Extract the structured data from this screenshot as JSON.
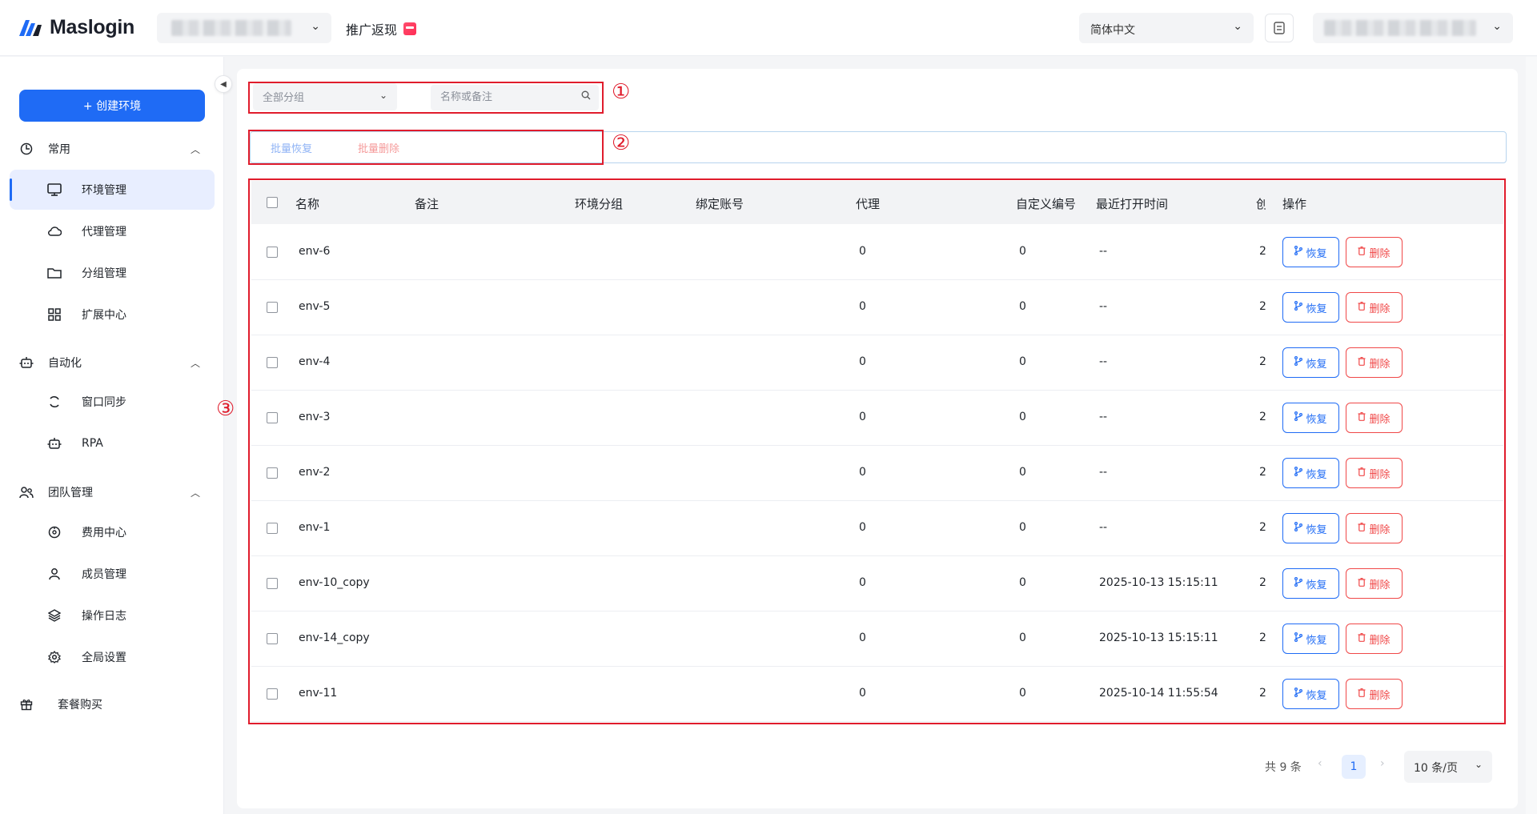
{
  "header": {
    "logo_text": "Maslogin",
    "promo_label": "推广返现",
    "language": "简体中文"
  },
  "sidebar": {
    "create_label": "+ 创建环境",
    "groups": [
      {
        "label": "常用",
        "icon": "dashboard-icon"
      },
      {
        "label": "自动化",
        "icon": "robot-icon"
      },
      {
        "label": "团队管理",
        "icon": "team-icon"
      }
    ],
    "items": [
      {
        "label": "环境管理",
        "icon": "monitor-icon",
        "active": true
      },
      {
        "label": "代理管理",
        "icon": "cloud-icon"
      },
      {
        "label": "分组管理",
        "icon": "folder-icon"
      },
      {
        "label": "扩展中心",
        "icon": "grid-icon"
      },
      {
        "label": "窗口同步",
        "icon": "sync-icon"
      },
      {
        "label": "RPA",
        "icon": "robot-icon"
      },
      {
        "label": "费用中心",
        "icon": "billing-icon"
      },
      {
        "label": "成员管理",
        "icon": "user-icon"
      },
      {
        "label": "操作日志",
        "icon": "layers-icon"
      },
      {
        "label": "全局设置",
        "icon": "gear-icon"
      }
    ],
    "package_label": "套餐购买"
  },
  "filters": {
    "group_select": "全部分组",
    "search_placeholder": "名称或备注"
  },
  "batch": {
    "restore_label": "批量恢复",
    "delete_label": "批量删除"
  },
  "annotations": [
    "①",
    "②",
    "③"
  ],
  "table": {
    "columns": [
      "名称",
      "备注",
      "环境分组",
      "绑定账号",
      "代理",
      "自定义编号",
      "最近打开时间",
      "创",
      "操作"
    ],
    "restore_label": "恢复",
    "delete_label": "删除",
    "rows": [
      {
        "name": "env-6",
        "proxy": "0",
        "custom_no": "0",
        "last_open": "--",
        "created": "2"
      },
      {
        "name": "env-5",
        "proxy": "0",
        "custom_no": "0",
        "last_open": "--",
        "created": "2"
      },
      {
        "name": "env-4",
        "proxy": "0",
        "custom_no": "0",
        "last_open": "--",
        "created": "2"
      },
      {
        "name": "env-3",
        "proxy": "0",
        "custom_no": "0",
        "last_open": "--",
        "created": "2"
      },
      {
        "name": "env-2",
        "proxy": "0",
        "custom_no": "0",
        "last_open": "--",
        "created": "2"
      },
      {
        "name": "env-1",
        "proxy": "0",
        "custom_no": "0",
        "last_open": "--",
        "created": "2"
      },
      {
        "name": "env-10_copy",
        "proxy": "0",
        "custom_no": "0",
        "last_open": "2025-10-13 15:15:11",
        "created": "2"
      },
      {
        "name": "env-14_copy",
        "proxy": "0",
        "custom_no": "0",
        "last_open": "2025-10-13 15:15:11",
        "created": "2"
      },
      {
        "name": "env-11",
        "proxy": "0",
        "custom_no": "0",
        "last_open": "2025-10-14 11:55:54",
        "created": "2"
      }
    ]
  },
  "pagination": {
    "total": "共 9 条",
    "page": "1",
    "page_size": "10 条/页"
  },
  "colors": {
    "accent": "#1f6bf5",
    "danger": "#f04848",
    "annotation": "#e01c2c"
  }
}
